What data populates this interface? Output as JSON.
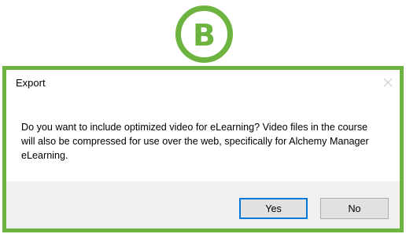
{
  "callout": {
    "letter": "B",
    "color": "#6cb33f"
  },
  "dialog": {
    "title": "Export",
    "close_icon": "close-icon",
    "message": "Do you want to include optimized video for eLearning? Video files in the course\nwill also be compressed for use over the web, specifically for Alchemy Manager\neLearning.",
    "buttons": {
      "yes_label": "Yes",
      "no_label": "No",
      "default_button": "Yes",
      "default_border_color": "#0078d7"
    }
  }
}
